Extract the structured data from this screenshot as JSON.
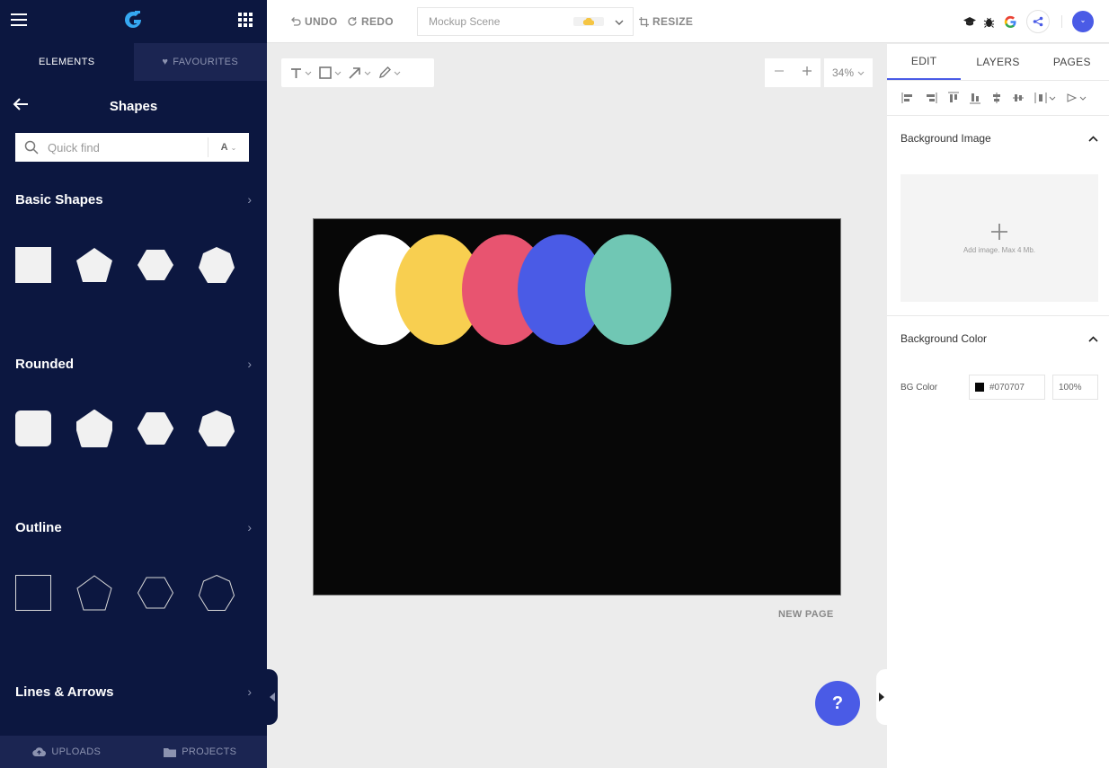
{
  "colors": {
    "sidebar_bg": "#0c1740",
    "accent": "#4a5be6",
    "canvas_bg": "#070707"
  },
  "sidebar": {
    "tabs": [
      {
        "label": "ELEMENTS",
        "active": true
      },
      {
        "label": "FAVOURITES",
        "active": false,
        "icon": "heart-icon"
      }
    ],
    "panel_title": "Shapes",
    "search": {
      "placeholder": "Quick find",
      "font_button": "A"
    },
    "sections": [
      {
        "title": "Basic Shapes",
        "style": "filled"
      },
      {
        "title": "Rounded",
        "style": "rounded"
      },
      {
        "title": "Outline",
        "style": "outline"
      },
      {
        "title": "Lines & Arrows",
        "style": "lines"
      }
    ],
    "bottom": [
      {
        "label": "UPLOADS",
        "icon": "cloud-upload-icon"
      },
      {
        "label": "PROJECTS",
        "icon": "folder-icon"
      }
    ]
  },
  "topbar": {
    "undo": "UNDO",
    "redo": "REDO",
    "document_name": "Mockup Scene",
    "resize": "RESIZE"
  },
  "toolbox": {
    "zoom": "34%"
  },
  "canvas": {
    "background": "#070707",
    "ellipses": [
      {
        "color": "#ffffff"
      },
      {
        "color": "#f8cf50"
      },
      {
        "color": "#e85470"
      },
      {
        "color": "#4a5be6"
      },
      {
        "color": "#70c7b4"
      }
    ],
    "new_page": "NEW PAGE",
    "help": "?"
  },
  "right_panel": {
    "tabs": [
      {
        "label": "EDIT",
        "active": true
      },
      {
        "label": "LAYERS",
        "active": false
      },
      {
        "label": "PAGES",
        "active": false
      }
    ],
    "background_image": {
      "title": "Background Image",
      "hint": "Add image. Max 4 Mb."
    },
    "background_color": {
      "title": "Background Color",
      "label": "BG Color",
      "hex": "#070707",
      "opacity": "100%"
    }
  }
}
